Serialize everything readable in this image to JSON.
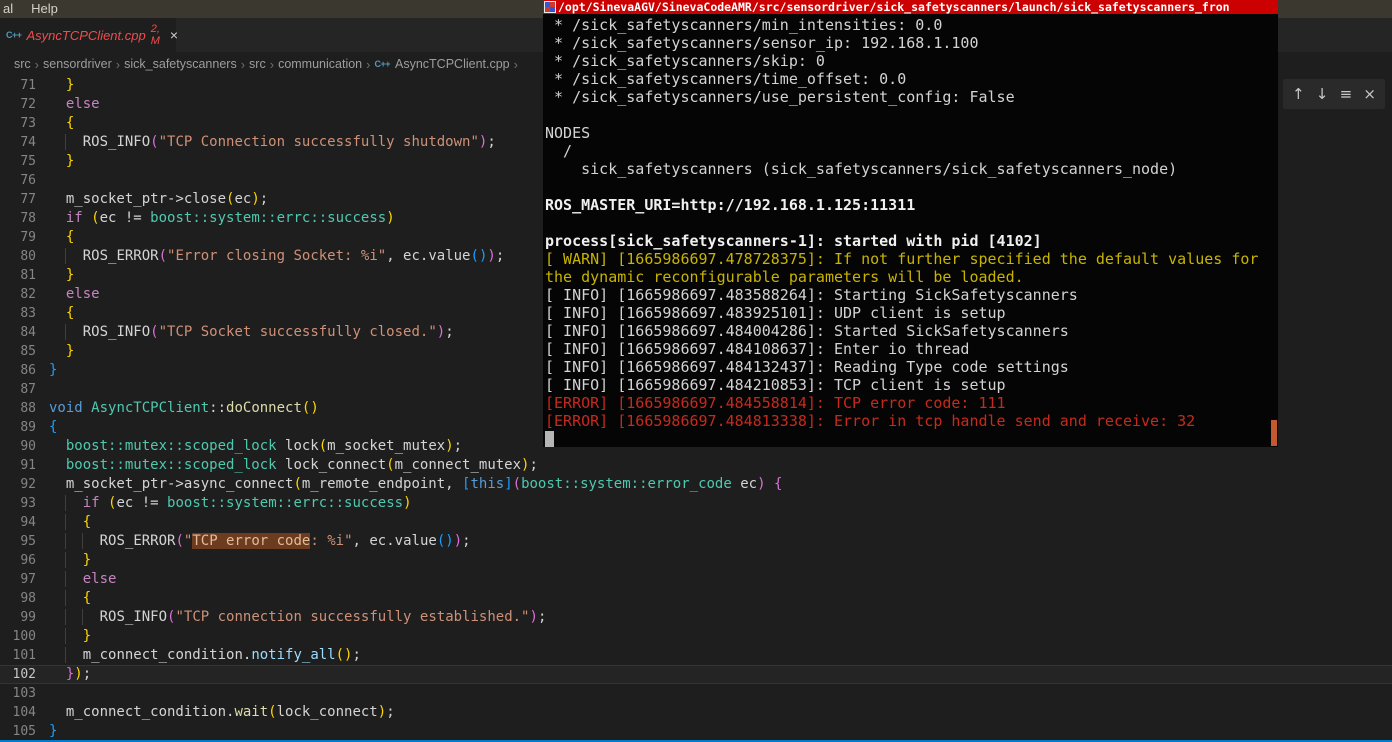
{
  "menu_bar": {
    "items": [
      "al",
      "Help"
    ]
  },
  "tab": {
    "icon": "cpp-file-icon",
    "icon_glyph": "C++",
    "title": "AsyncTCPClient.cpp",
    "badge": "2, M",
    "close_glyph": "×"
  },
  "breadcrumb": {
    "separator": "›",
    "items": [
      "src",
      "sensordriver",
      "sick_safetyscanners",
      "src",
      "communication",
      "AsyncTCPClient.cpp"
    ],
    "file_item_index": 5,
    "trailing_separator": "›"
  },
  "float_toolbar": {
    "icons": [
      {
        "name": "arrow-up-icon",
        "glyph": "↑"
      },
      {
        "name": "arrow-down-icon",
        "glyph": "↓"
      },
      {
        "name": "filter-icon",
        "glyph": "≡"
      },
      {
        "name": "close-icon",
        "glyph": "×"
      }
    ]
  },
  "editor": {
    "active_line": 102,
    "lines": [
      {
        "n": 71,
        "seg": [
          [
            "  ",
            "w"
          ],
          [
            "}",
            "y"
          ]
        ]
      },
      {
        "n": 72,
        "seg": [
          [
            "  ",
            "w"
          ],
          [
            "else",
            "k"
          ]
        ]
      },
      {
        "n": 73,
        "seg": [
          [
            "  ",
            "w"
          ],
          [
            "{",
            "y"
          ]
        ]
      },
      {
        "n": 74,
        "seg": [
          [
            "  ",
            "w"
          ],
          [
            " ",
            "g"
          ],
          [
            " ",
            "w"
          ],
          [
            "ROS_INFO",
            "w"
          ],
          [
            "(",
            "o"
          ],
          [
            "\"TCP Connection successfully shutdown\"",
            "s"
          ],
          [
            ")",
            "o"
          ],
          [
            ";",
            "w"
          ]
        ]
      },
      {
        "n": 75,
        "seg": [
          [
            "  ",
            "w"
          ],
          [
            "}",
            "y"
          ]
        ]
      },
      {
        "n": 76,
        "seg": []
      },
      {
        "n": 77,
        "seg": [
          [
            "  ",
            "w"
          ],
          [
            "m_socket_ptr->close",
            "w"
          ],
          [
            "(",
            "y"
          ],
          [
            "ec",
            "w"
          ],
          [
            ")",
            "y"
          ],
          [
            ";",
            "w"
          ]
        ]
      },
      {
        "n": 78,
        "seg": [
          [
            "  ",
            "w"
          ],
          [
            "if",
            "k"
          ],
          [
            " ",
            "w"
          ],
          [
            "(",
            "y"
          ],
          [
            "ec",
            "w"
          ],
          [
            " != ",
            "w"
          ],
          [
            "boost::system::errc::success",
            "t"
          ],
          [
            ")",
            "y"
          ]
        ]
      },
      {
        "n": 79,
        "seg": [
          [
            "  ",
            "w"
          ],
          [
            "{",
            "y"
          ]
        ]
      },
      {
        "n": 80,
        "seg": [
          [
            "  ",
            "w"
          ],
          [
            " ",
            "g"
          ],
          [
            " ",
            "w"
          ],
          [
            "ROS_ERROR",
            "w"
          ],
          [
            "(",
            "o"
          ],
          [
            "\"Error closing Socket: %i\"",
            "s"
          ],
          [
            ", ",
            "w"
          ],
          [
            "ec.",
            "w"
          ],
          [
            "value",
            "w"
          ],
          [
            "(",
            "u"
          ],
          [
            ")",
            "u"
          ],
          [
            ")",
            "o"
          ],
          [
            ";",
            "w"
          ]
        ]
      },
      {
        "n": 81,
        "seg": [
          [
            "  ",
            "w"
          ],
          [
            "}",
            "y"
          ]
        ]
      },
      {
        "n": 82,
        "seg": [
          [
            "  ",
            "w"
          ],
          [
            "else",
            "k"
          ]
        ]
      },
      {
        "n": 83,
        "seg": [
          [
            "  ",
            "w"
          ],
          [
            "{",
            "y"
          ]
        ]
      },
      {
        "n": 84,
        "seg": [
          [
            "  ",
            "w"
          ],
          [
            " ",
            "g"
          ],
          [
            " ",
            "w"
          ],
          [
            "ROS_INFO",
            "w"
          ],
          [
            "(",
            "o"
          ],
          [
            "\"TCP Socket successfully closed.\"",
            "s"
          ],
          [
            ")",
            "o"
          ],
          [
            ";",
            "w"
          ]
        ]
      },
      {
        "n": 85,
        "seg": [
          [
            "  ",
            "w"
          ],
          [
            "}",
            "y"
          ]
        ]
      },
      {
        "n": 86,
        "seg": [
          [
            "}",
            "u"
          ]
        ]
      },
      {
        "n": 87,
        "seg": []
      },
      {
        "n": 88,
        "seg": [
          [
            "void",
            "b"
          ],
          [
            " ",
            "w"
          ],
          [
            "AsyncTCPClient",
            "t"
          ],
          [
            "::",
            "w"
          ],
          [
            "doConnect",
            "f"
          ],
          [
            "()",
            "y"
          ]
        ]
      },
      {
        "n": 89,
        "seg": [
          [
            "{",
            "u"
          ]
        ]
      },
      {
        "n": 90,
        "seg": [
          [
            "  ",
            "w"
          ],
          [
            "boost::mutex::scoped_lock",
            "t"
          ],
          [
            " ",
            "w"
          ],
          [
            "lock",
            "w"
          ],
          [
            "(",
            "y"
          ],
          [
            "m_socket_mutex",
            "w"
          ],
          [
            ")",
            "y"
          ],
          [
            ";",
            "w"
          ]
        ]
      },
      {
        "n": 91,
        "seg": [
          [
            "  ",
            "w"
          ],
          [
            "boost::mutex::scoped_lock",
            "t"
          ],
          [
            " ",
            "w"
          ],
          [
            "lock_connect",
            "w"
          ],
          [
            "(",
            "y"
          ],
          [
            "m_connect_mutex",
            "w"
          ],
          [
            ")",
            "y"
          ],
          [
            ";",
            "w"
          ]
        ]
      },
      {
        "n": 92,
        "seg": [
          [
            "  ",
            "w"
          ],
          [
            "m_socket_ptr->async_connect",
            "w"
          ],
          [
            "(",
            "y"
          ],
          [
            "m_remote_endpoint",
            "w"
          ],
          [
            ", ",
            "w"
          ],
          [
            "[",
            "u"
          ],
          [
            "this",
            "b"
          ],
          [
            "]",
            "u"
          ],
          [
            "(",
            "o"
          ],
          [
            "boost::system::error_code",
            "t"
          ],
          [
            " ec",
            "w"
          ],
          [
            ")",
            "o"
          ],
          [
            " ",
            "w"
          ],
          [
            "{",
            "o"
          ]
        ]
      },
      {
        "n": 93,
        "seg": [
          [
            "  ",
            "w"
          ],
          [
            " ",
            "g"
          ],
          [
            " ",
            "w"
          ],
          [
            "if",
            "k"
          ],
          [
            " ",
            "w"
          ],
          [
            "(",
            "y"
          ],
          [
            "ec",
            "w"
          ],
          [
            " != ",
            "w"
          ],
          [
            "boost::system::errc::success",
            "t"
          ],
          [
            ")",
            "y"
          ]
        ]
      },
      {
        "n": 94,
        "seg": [
          [
            "  ",
            "w"
          ],
          [
            " ",
            "g"
          ],
          [
            " ",
            "w"
          ],
          [
            "{",
            "y"
          ]
        ]
      },
      {
        "n": 95,
        "seg": [
          [
            "  ",
            "w"
          ],
          [
            " ",
            "g"
          ],
          [
            " ",
            "w"
          ],
          [
            " ",
            "g"
          ],
          [
            " ",
            "w"
          ],
          [
            "ROS_ERROR",
            "w"
          ],
          [
            "(",
            "o"
          ],
          [
            "\"",
            "s"
          ],
          [
            "TCP error code",
            "sh"
          ],
          [
            ": %i\"",
            "s"
          ],
          [
            ", ",
            "w"
          ],
          [
            "ec.",
            "w"
          ],
          [
            "value",
            "w"
          ],
          [
            "(",
            "u"
          ],
          [
            ")",
            "u"
          ],
          [
            ")",
            "o"
          ],
          [
            ";",
            "w"
          ]
        ]
      },
      {
        "n": 96,
        "seg": [
          [
            "  ",
            "w"
          ],
          [
            " ",
            "g"
          ],
          [
            " ",
            "w"
          ],
          [
            "}",
            "y"
          ]
        ]
      },
      {
        "n": 97,
        "seg": [
          [
            "  ",
            "w"
          ],
          [
            " ",
            "g"
          ],
          [
            " ",
            "w"
          ],
          [
            "else",
            "k"
          ]
        ]
      },
      {
        "n": 98,
        "seg": [
          [
            "  ",
            "w"
          ],
          [
            " ",
            "g"
          ],
          [
            " ",
            "w"
          ],
          [
            "{",
            "y"
          ]
        ]
      },
      {
        "n": 99,
        "seg": [
          [
            "  ",
            "w"
          ],
          [
            " ",
            "g"
          ],
          [
            " ",
            "w"
          ],
          [
            " ",
            "g"
          ],
          [
            " ",
            "w"
          ],
          [
            "ROS_INFO",
            "w"
          ],
          [
            "(",
            "o"
          ],
          [
            "\"TCP connection successfully established.\"",
            "s"
          ],
          [
            ")",
            "o"
          ],
          [
            ";",
            "w"
          ]
        ]
      },
      {
        "n": 100,
        "seg": [
          [
            "  ",
            "w"
          ],
          [
            " ",
            "g"
          ],
          [
            " ",
            "w"
          ],
          [
            "}",
            "y"
          ]
        ]
      },
      {
        "n": 101,
        "seg": [
          [
            "  ",
            "w"
          ],
          [
            " ",
            "g"
          ],
          [
            " ",
            "w"
          ],
          [
            "m_connect_condition.",
            "w"
          ],
          [
            "notify_all",
            "v"
          ],
          [
            "(",
            "y"
          ],
          [
            ")",
            "y"
          ],
          [
            ";",
            "w"
          ]
        ]
      },
      {
        "n": 102,
        "seg": [
          [
            "  ",
            "w"
          ],
          [
            "}",
            "o"
          ],
          [
            ")",
            "y"
          ],
          [
            ";",
            "w"
          ]
        ]
      },
      {
        "n": 103,
        "seg": []
      },
      {
        "n": 104,
        "seg": [
          [
            "  ",
            "w"
          ],
          [
            "m_connect_condition.",
            "w"
          ],
          [
            "wait",
            "f"
          ],
          [
            "(",
            "y"
          ],
          [
            "lock_connect",
            "w"
          ],
          [
            ")",
            "y"
          ],
          [
            ";",
            "w"
          ]
        ]
      },
      {
        "n": 105,
        "seg": [
          [
            "}",
            "u"
          ]
        ]
      }
    ]
  },
  "terminal": {
    "title": "/opt/SinevaAGV/SinevaCodeAMR/src/sensordriver/sick_safetyscanners/launch/sick_safetyscanners_fron",
    "lines": [
      {
        "t": " * /sick_safetyscanners/min_intensities: 0.0",
        "c": "p"
      },
      {
        "t": " * /sick_safetyscanners/sensor_ip: 192.168.1.100",
        "c": "p"
      },
      {
        "t": " * /sick_safetyscanners/skip: 0",
        "c": "p"
      },
      {
        "t": " * /sick_safetyscanners/time_offset: 0.0",
        "c": "p"
      },
      {
        "t": " * /sick_safetyscanners/use_persistent_config: False",
        "c": "p"
      },
      {
        "t": "",
        "c": "p"
      },
      {
        "t": "NODES",
        "c": "p"
      },
      {
        "t": "  /",
        "c": "p"
      },
      {
        "t": "    sick_safetyscanners (sick_safetyscanners/sick_safetyscanners_node)",
        "c": "p"
      },
      {
        "t": "",
        "c": "p"
      },
      {
        "t": "ROS_MASTER_URI=http://192.168.1.125:11311",
        "c": "b"
      },
      {
        "t": "",
        "c": "p"
      },
      {
        "t": "process[sick_safetyscanners-1]: started with pid [4102]",
        "c": "b"
      },
      {
        "t": "[ WARN] [1665986697.478728375]: If not further specified the default values for",
        "c": "w"
      },
      {
        "t": "the dynamic reconfigurable parameters will be loaded.",
        "c": "w"
      },
      {
        "t": "[ INFO] [1665986697.483588264]: Starting SickSafetyscanners",
        "c": "p"
      },
      {
        "t": "[ INFO] [1665986697.483925101]: UDP client is setup",
        "c": "p"
      },
      {
        "t": "[ INFO] [1665986697.484004286]: Started SickSafetyscanners",
        "c": "p"
      },
      {
        "t": "[ INFO] [1665986697.484108637]: Enter io thread",
        "c": "p"
      },
      {
        "t": "[ INFO] [1665986697.484132437]: Reading Type code settings",
        "c": "p"
      },
      {
        "t": "[ INFO] [1665986697.484210853]: TCP client is setup",
        "c": "p"
      },
      {
        "t": "[ERROR] [1665986697.484558814]: TCP error code: 111",
        "c": "e"
      },
      {
        "t": "[ERROR] [1665986697.484813338]: Error in tcp handle send and receive: 32",
        "c": "e"
      },
      {
        "t": "",
        "c": "p",
        "cursor": true
      }
    ]
  },
  "colors": {
    "status_bar": "#007acc",
    "terminal_title_bg": "#cc0000",
    "terminal_scroll_thumb": "#c4582f",
    "tab_error_text": "#f14c4c",
    "warn_text": "#c8b400",
    "error_text": "#c52b1d",
    "match_highlight_bg": "#6d3b1f"
  }
}
